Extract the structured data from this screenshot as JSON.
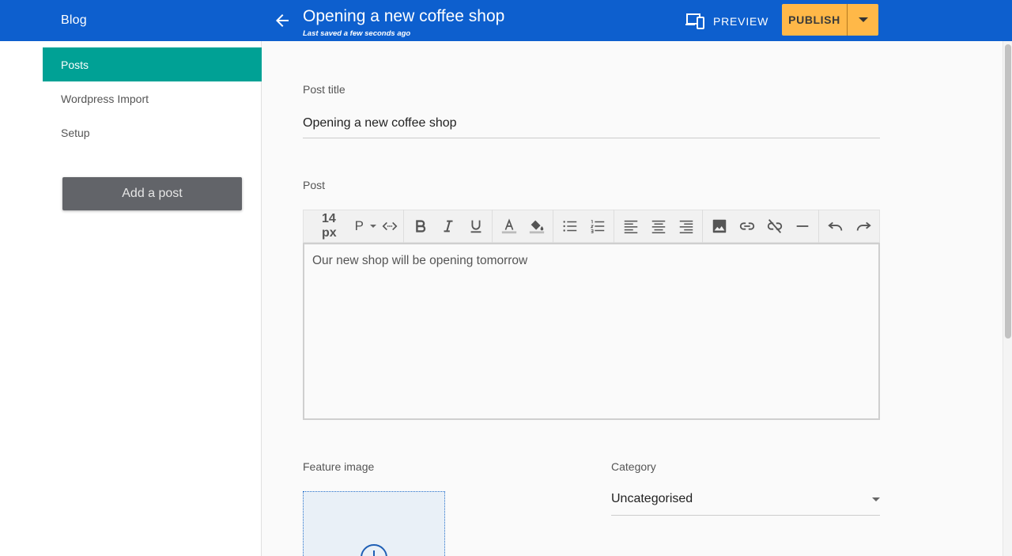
{
  "header": {
    "brand": "Blog",
    "title": "Opening a new coffee shop",
    "subtitle": "Last saved a few seconds ago",
    "preview_label": "PREVIEW",
    "publish_label": "PUBLISH",
    "color_bar": "#0d5fce",
    "color_publish": "#ffb848"
  },
  "sidebar": {
    "items": [
      {
        "label": "Posts",
        "active": true
      },
      {
        "label": "Wordpress Import",
        "active": false
      },
      {
        "label": "Setup",
        "active": false
      }
    ],
    "add_button": "Add a post",
    "active_color": "#00a195"
  },
  "form": {
    "title_label": "Post title",
    "title_value": "Opening a new coffee shop",
    "post_label": "Post",
    "font_size": "14 px",
    "paragraph": "P",
    "body_text": "Our new shop will be opening tomorrow",
    "feature_label": "Feature image",
    "category_label": "Category",
    "category_value": "Uncategorised"
  },
  "toolbar_icons": [
    "code-view-icon",
    "bold-icon",
    "italic-icon",
    "underline-icon",
    "font-color-icon",
    "fill-color-icon",
    "bullet-list-icon",
    "numbered-list-icon",
    "align-left-icon",
    "align-center-icon",
    "align-right-icon",
    "image-icon",
    "link-icon",
    "unlink-icon",
    "horizontal-rule-icon",
    "undo-icon",
    "redo-icon"
  ]
}
